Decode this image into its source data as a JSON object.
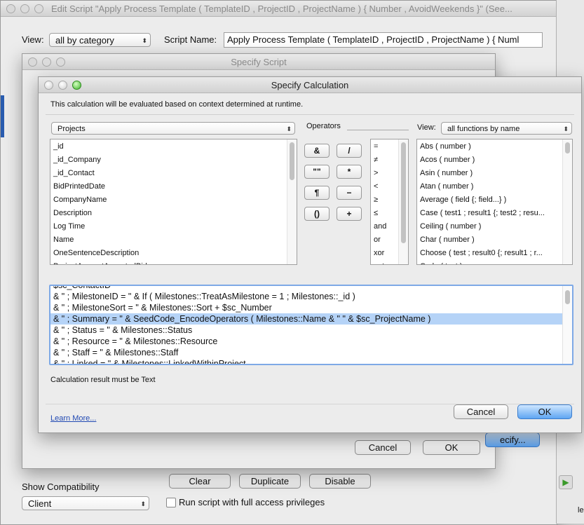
{
  "edit_script": {
    "title": "Edit Script \"Apply Process Template ( TemplateID , ProjectID , ProjectName ) { Number , AvoidWeekends }\" (See...",
    "view_label": "View:",
    "view_value": "all by category",
    "script_name_label": "Script Name:",
    "script_name_value": "Apply Process Template ( TemplateID , ProjectID , ProjectName ) { Numl",
    "show_compat_label": "Show Compatibility",
    "show_compat_value": "Client",
    "clear_label": "Clear",
    "duplicate_label": "Duplicate",
    "disable_label": "Disable",
    "run_full_access_label": "Run script with full access privileges",
    "side_fragment": "le"
  },
  "specify_script": {
    "title": "Specify Script",
    "cancel_label": "Cancel",
    "ok_label": "OK",
    "specify_fragment": "ecify..."
  },
  "specify_calc": {
    "title": "Specify Calculation",
    "context_text": "This calculation will be evaluated based on context determined at runtime.",
    "table_select": "Projects",
    "operators_label": "Operators",
    "view_label": "View:",
    "view_value": "all functions by name",
    "fields": [
      "_id",
      "_id_Company",
      "_id_Contact",
      "BidPrintedDate",
      "CompanyName",
      "Description",
      "Log Time",
      "Name",
      "OneSentenceDescription",
      "ProjectAmountAcceptedBids"
    ],
    "operator_buttons": [
      "&",
      "/",
      "\"\"",
      "*",
      "¶",
      "−",
      "()",
      "+"
    ],
    "operator_list": [
      "=",
      "≠",
      ">",
      "<",
      "≥",
      "≤",
      "and",
      "or",
      "xor",
      "not"
    ],
    "functions": [
      "Abs ( number )",
      "Acos ( number )",
      "Asin ( number )",
      "Atan ( number )",
      "Average ( field {; field...} )",
      "Case ( test1 ; result1 {; test2 ; resu...",
      "Ceiling ( number )",
      "Char ( number )",
      "Choose ( test ; result0 {; result1 ; r...",
      "Code ( text )"
    ],
    "calc_lines": [
      "$sc_ContactID",
      "& \" ; MilestoneID = \" & If ( Milestones::TreatAsMilestone = 1 ; Milestones::_id  )",
      "& \" ; MilestoneSort = \" & Milestones::Sort + $sc_Number",
      "& \" ; Summary = \" & SeedCode_EncodeOperators ( Milestones::Name & \" \" & $sc_ProjectName )",
      "& \" ; Status = \" & Milestones::Status",
      "& \" ; Resource = \" & Milestones::Resource",
      "& \" ; Staff = \" & Milestones::Staff",
      "& \" ; Linked = \" & Milestones::LinkedWithinProject"
    ],
    "result_type_text": "Calculation result must be Text",
    "learn_more": "Learn More...",
    "cancel_label": "Cancel",
    "ok_label": "OK"
  },
  "colors": {
    "selection": "#b5d3f7",
    "default_button": "#5ea5f2",
    "link": "#2149b3"
  }
}
